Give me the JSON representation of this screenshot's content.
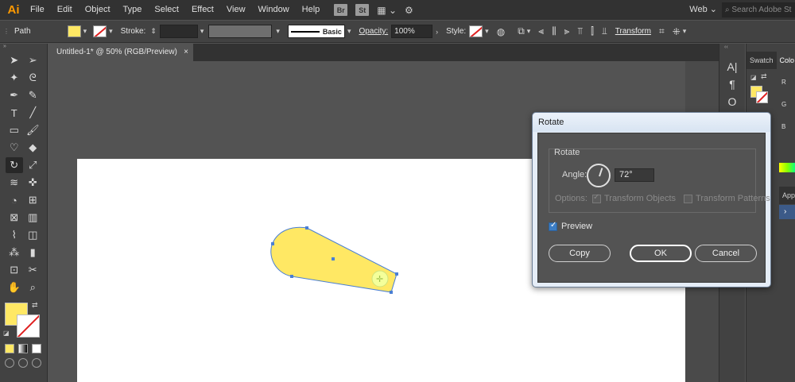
{
  "menubar": {
    "logo": "Ai",
    "items": [
      "File",
      "Edit",
      "Object",
      "Type",
      "Select",
      "Effect",
      "View",
      "Window",
      "Help"
    ],
    "bridge": "Br",
    "stock": "St",
    "workspace": "Web",
    "search_placeholder": "Search Adobe St"
  },
  "control": {
    "selection": "Path",
    "stroke_label": "Stroke:",
    "stroke_profile": "Basic",
    "opacity_label": "Opacity:",
    "opacity_value": "100%",
    "style_label": "Style:",
    "transform_label": "Transform",
    "fill_color": "#ffe864",
    "stroke_none_color": "#e02020"
  },
  "document": {
    "tab_title": "Untitled-1* @ 50% (RGB/Preview)",
    "close": "×"
  },
  "panels": {
    "tab_swatches": "Swatch",
    "tab_color": "Colo",
    "channels": [
      "R",
      "G",
      "B"
    ],
    "sub_tab": "App",
    "expand": "›"
  },
  "dialog": {
    "title": "Rotate",
    "group_title": "Rotate",
    "angle_label": "Angle:",
    "angle_value": "72°",
    "options_label": "Options:",
    "transform_objects": "Transform Objects",
    "transform_patterns": "Transform Patterns",
    "preview_label": "Preview",
    "copy_label": "Copy",
    "ok_label": "OK",
    "cancel_label": "Cancel"
  }
}
